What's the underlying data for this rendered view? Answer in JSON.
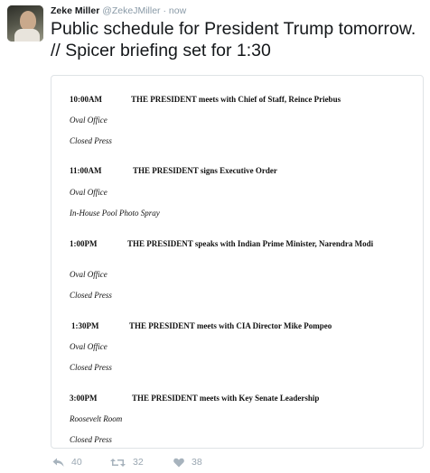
{
  "tweet": {
    "author_name": "Zeke Miller",
    "handle": "@ZekeJMiller",
    "separator": "·",
    "time": "now",
    "text": "Public schedule for President Trump tomorrow. // Spicer briefing set for 1:30"
  },
  "schedule": [
    {
      "time": "10:00AM",
      "description": "THE PRESIDENT meets with Chief of Staff, Reince Priebus",
      "location": "Oval Office",
      "coverage": "Closed Press"
    },
    {
      "time": "11:00AM",
      "description": "THE PRESIDENT signs Executive Order",
      "location": "Oval Office",
      "coverage": "In-House Pool Photo Spray"
    },
    {
      "time": "1:00PM",
      "description": "THE PRESIDENT speaks with Indian Prime Minister, Narendra Modi",
      "location": "Oval Office",
      "coverage": "Closed Press"
    },
    {
      "time": "1:30PM",
      "description": "THE PRESIDENT meets with CIA Director Mike Pompeo",
      "location": "Oval Office",
      "coverage": "Closed Press"
    },
    {
      "time": "3:00PM",
      "description": "THE PRESIDENT meets with Key Senate Leadership",
      "location": "Roosevelt Room",
      "coverage": "Closed Press"
    }
  ],
  "actions": {
    "reply_count": "40",
    "retweet_count": "32",
    "like_count": "38"
  },
  "icons": {
    "reply": "reply-icon",
    "retweet": "retweet-icon",
    "like": "heart-icon"
  },
  "colors": {
    "text": "#14171a",
    "muted": "#8899a6",
    "border": "#dfe3e6"
  }
}
